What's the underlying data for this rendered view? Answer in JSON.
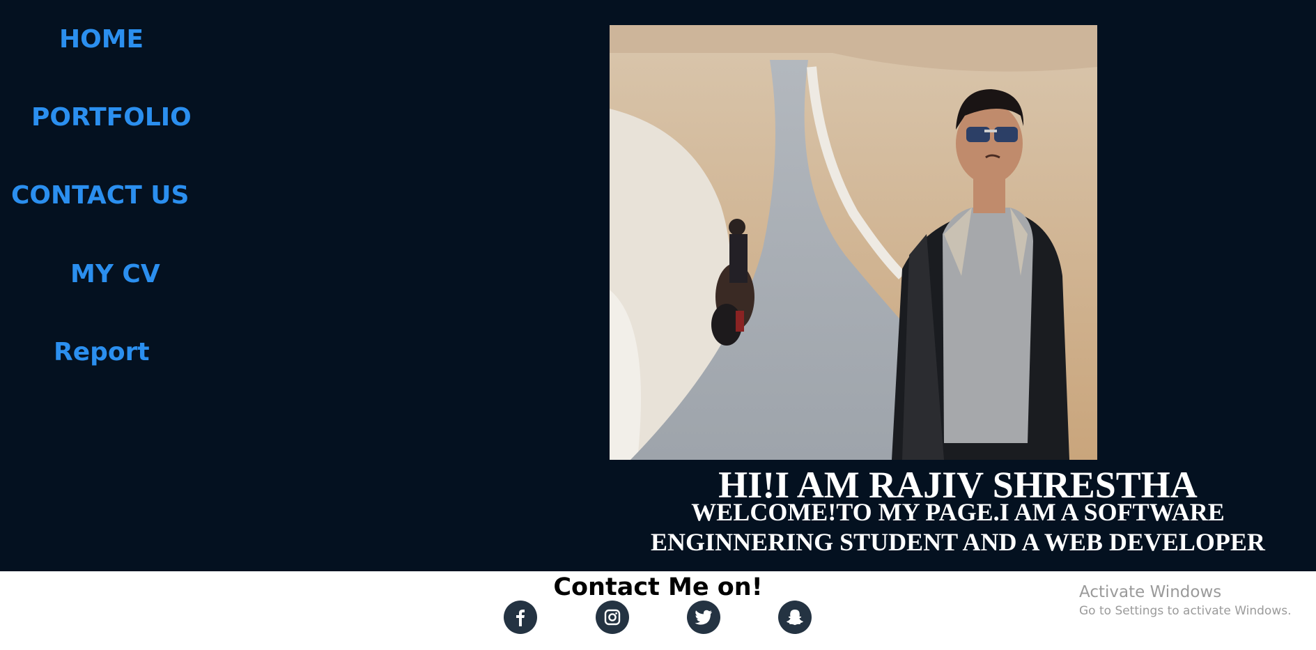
{
  "nav": {
    "items": [
      {
        "label": "HOME"
      },
      {
        "label": "PORTFOLIO"
      },
      {
        "label": "CONTACT US"
      },
      {
        "label": "MY CV"
      },
      {
        "label": "Report"
      }
    ],
    "color": "#2b8fef"
  },
  "hero": {
    "background": "#041120",
    "photo_icon": "profile-photo",
    "heading": "HI!I AM RAJIV SHRESTHA",
    "subheading_line1": "WELCOME!TO MY PAGE.I AM A SOFTWARE",
    "subheading_line2": "ENGINNERING STUDENT AND A WEB DEVELOPER"
  },
  "footer": {
    "title": "Contact Me on!",
    "social": [
      {
        "icon": "facebook-icon"
      },
      {
        "icon": "instagram-icon"
      },
      {
        "icon": "twitter-icon"
      },
      {
        "icon": "snapchat-icon"
      }
    ],
    "icon_background": "#243342"
  },
  "watermark": {
    "title": "Activate Windows",
    "subtitle": "Go to Settings to activate Windows."
  }
}
